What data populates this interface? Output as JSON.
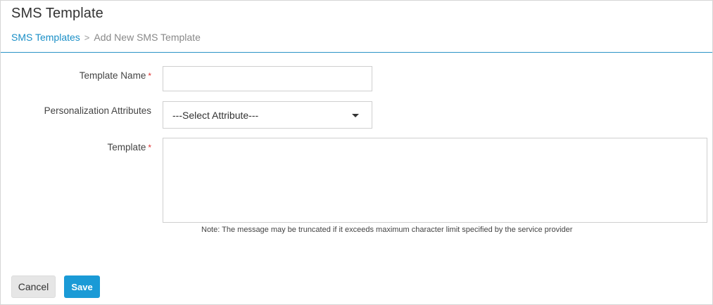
{
  "page": {
    "title": "SMS Template"
  },
  "breadcrumb": {
    "parent": "SMS Templates",
    "separator": ">",
    "current": "Add New SMS Template"
  },
  "form": {
    "template_name": {
      "label": "Template Name",
      "required_marker": "*",
      "value": "",
      "placeholder": ""
    },
    "personalization": {
      "label": "Personalization Attributes",
      "selected": "---Select Attribute---"
    },
    "template": {
      "label": "Template",
      "required_marker": "*",
      "value": ""
    },
    "note": "Note: The message may be truncated if it exceeds maximum character limit specified by the service provider"
  },
  "actions": {
    "cancel_label": "Cancel",
    "save_label": "Save"
  },
  "colors": {
    "accent": "#1a9ad6",
    "link": "#1a8fc7",
    "divider": "#2a93c6",
    "required": "#e03030"
  }
}
